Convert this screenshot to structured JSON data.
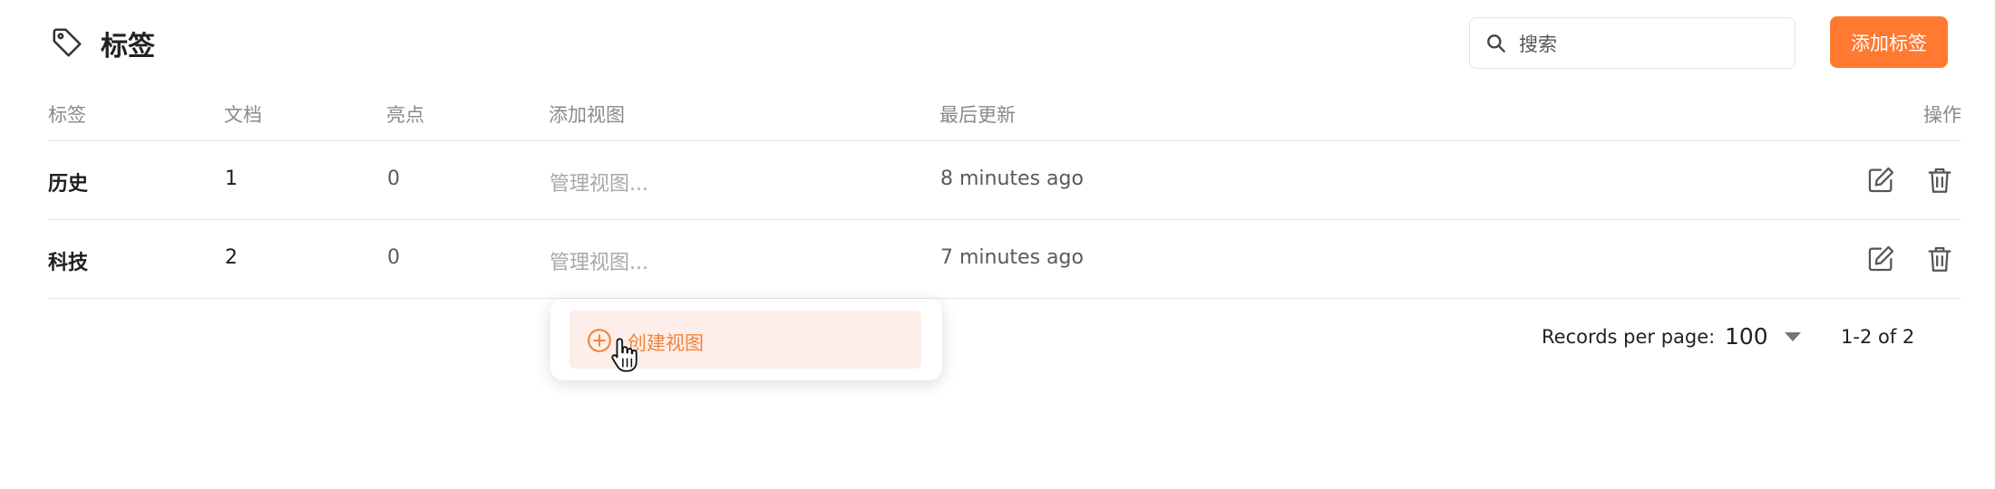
{
  "header": {
    "title": "标签",
    "title_icon": "tag-icon",
    "search_placeholder": "搜索",
    "search_icon": "search-icon",
    "add_button_label": "添加标签"
  },
  "colors": {
    "accent": "#ff7a30",
    "highlight_bg": "#fdeee9",
    "highlight_text": "#f0843c"
  },
  "table": {
    "columns": [
      "标签",
      "文档",
      "亮点",
      "添加视图",
      "最后更新",
      "操作"
    ],
    "rows": [
      {
        "tag": "历史",
        "documents": "1",
        "highlights": "0",
        "views": "管理视图...",
        "updated": "8 minutes ago"
      },
      {
        "tag": "科技",
        "documents": "2",
        "highlights": "0",
        "views": "管理视图...",
        "updated": "7 minutes ago"
      }
    ],
    "row_actions": [
      "edit-icon",
      "trash-icon"
    ]
  },
  "popup": {
    "item_label": "创建视图",
    "item_icon": "plus-circle-icon"
  },
  "pagination": {
    "records_per_page_label": "Records per page:",
    "records_per_page": "100",
    "range": "1-2 of 2"
  }
}
